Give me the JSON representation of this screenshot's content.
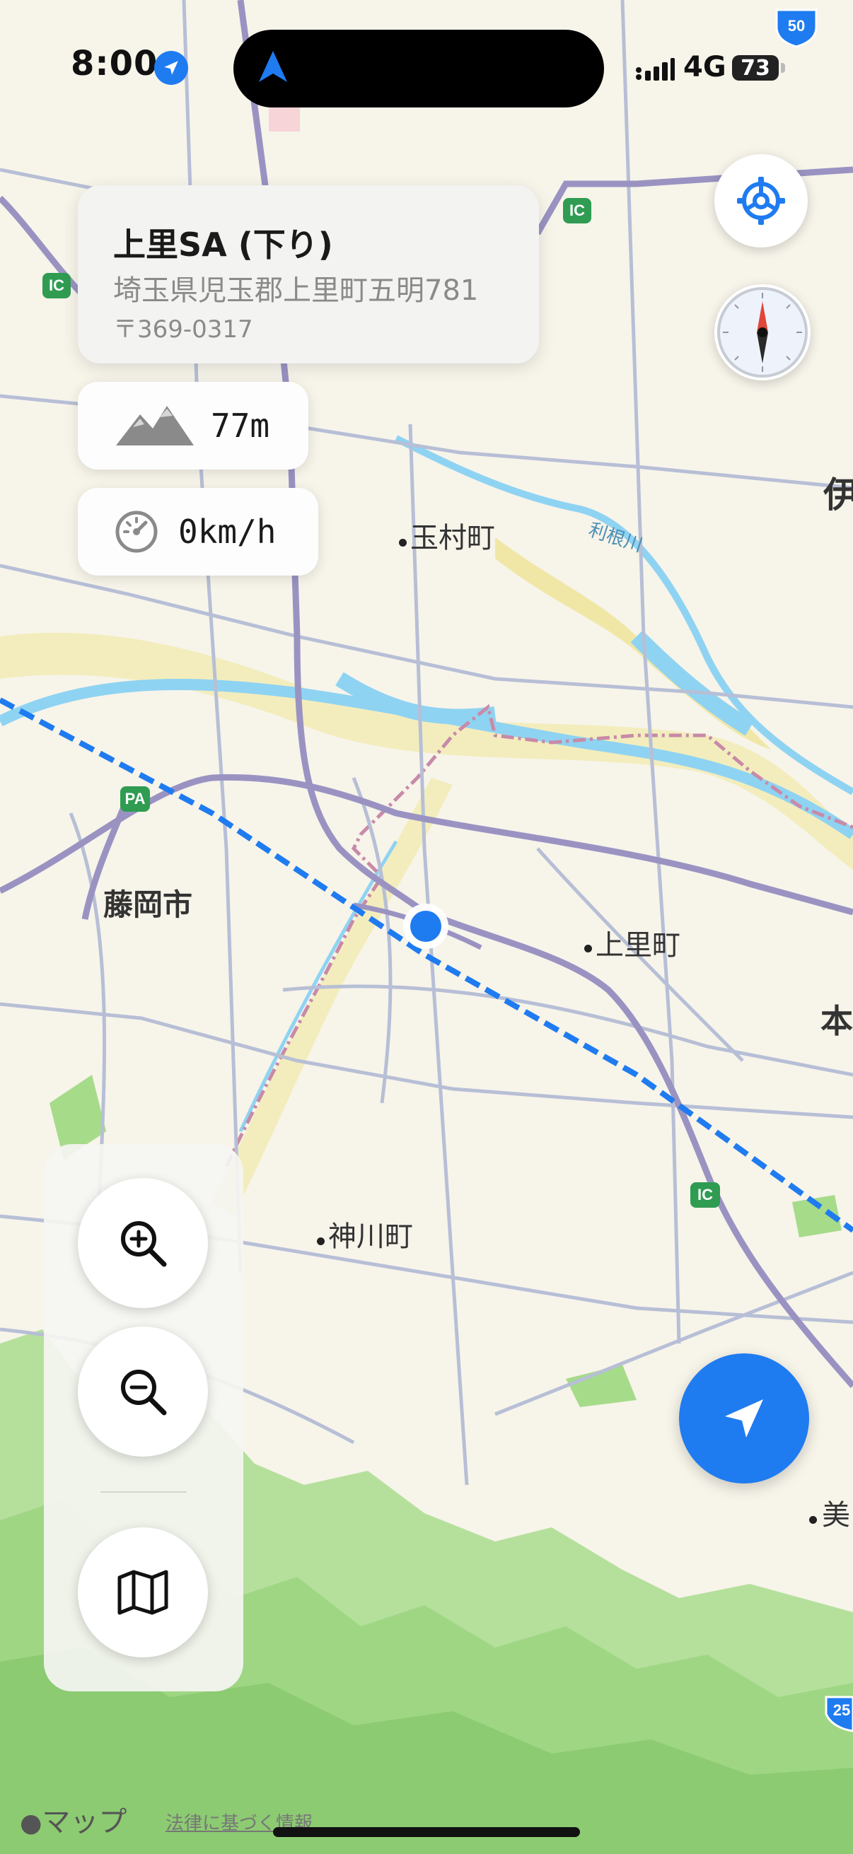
{
  "status_bar": {
    "time": "8:00",
    "network": "4G",
    "battery": "73"
  },
  "place_card": {
    "name": "上里SA (下り)",
    "address": "埼玉県児玉郡上里町五明781",
    "postal": "〒369-0317"
  },
  "altitude": {
    "value": "77m",
    "icon": "mountain-icon"
  },
  "speed": {
    "value": "0km/h",
    "icon": "speedometer-icon"
  },
  "map_labels": {
    "tamamura": "玉村町",
    "tone_river": "利根川",
    "fujioka": "藤岡市",
    "kamisato": "上里町",
    "kamikawa": "神川町",
    "edge_i": "伊",
    "edge_hon": "本",
    "edge_mi": "美",
    "route_50": "50",
    "route_25": "25",
    "ic_label": "IC",
    "pa_label": "PA"
  },
  "controls": {
    "settings": "gear-icon",
    "compass": "compass-icon",
    "zoom_in": "zoom-in-icon",
    "zoom_out": "zoom-out-icon",
    "map_type": "map-icon",
    "current_location": "location-arrow-icon"
  },
  "attribution": {
    "logo": "マップ",
    "legal": "法律に基づく情報"
  },
  "colors": {
    "accent_blue": "#1F7BF0",
    "card_bg": "#F3F3F1",
    "map_bg": "#F7F4EA",
    "river": "#8FD3F2",
    "forest": "#A6DB8A",
    "road": "#9A93C2"
  }
}
